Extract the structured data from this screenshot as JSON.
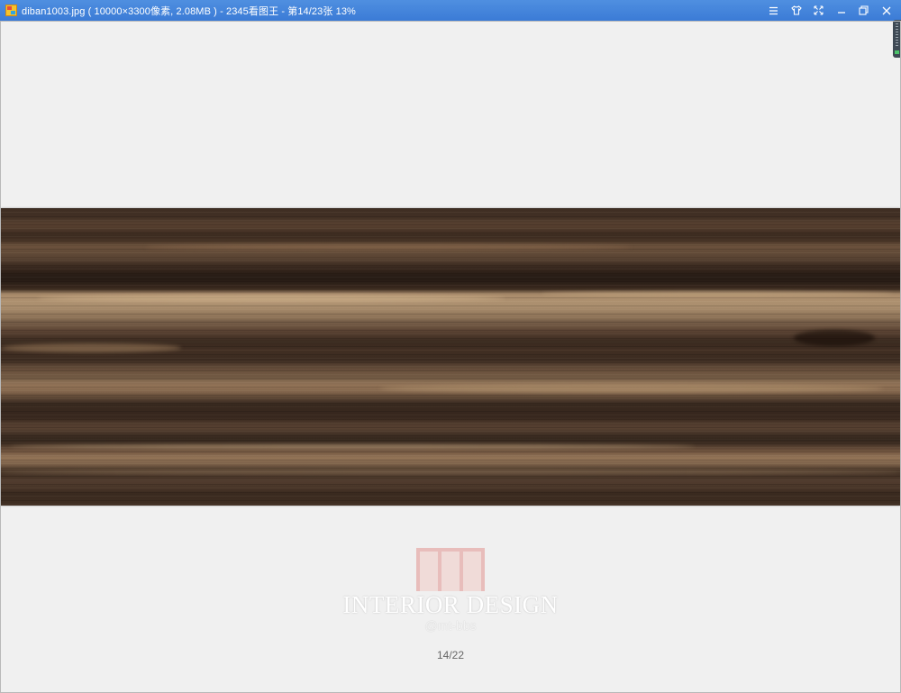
{
  "window": {
    "title": "diban1003.jpg ( 10000×3300像素, 2.08MB ) - 2345看图王 - 第14/23张 13%",
    "app_icon": "2345-viewer-icon",
    "controls": [
      {
        "name": "menu-icon"
      },
      {
        "name": "skin-icon"
      },
      {
        "name": "fullscreen-icon"
      },
      {
        "name": "minimize-icon"
      },
      {
        "name": "restore-icon"
      },
      {
        "name": "close-icon"
      }
    ],
    "accent_color": "#3f7fd9"
  },
  "image": {
    "description_icon": "wood-texture-image",
    "colors": [
      "#4a3527",
      "#b99b78",
      "#2e2119"
    ]
  },
  "watermark": {
    "title": "INTERIOR DESIGN",
    "subtitle": "@mt-bbs",
    "logo_icon": "mt-logo-icon"
  },
  "pager": {
    "text": "14/22"
  }
}
